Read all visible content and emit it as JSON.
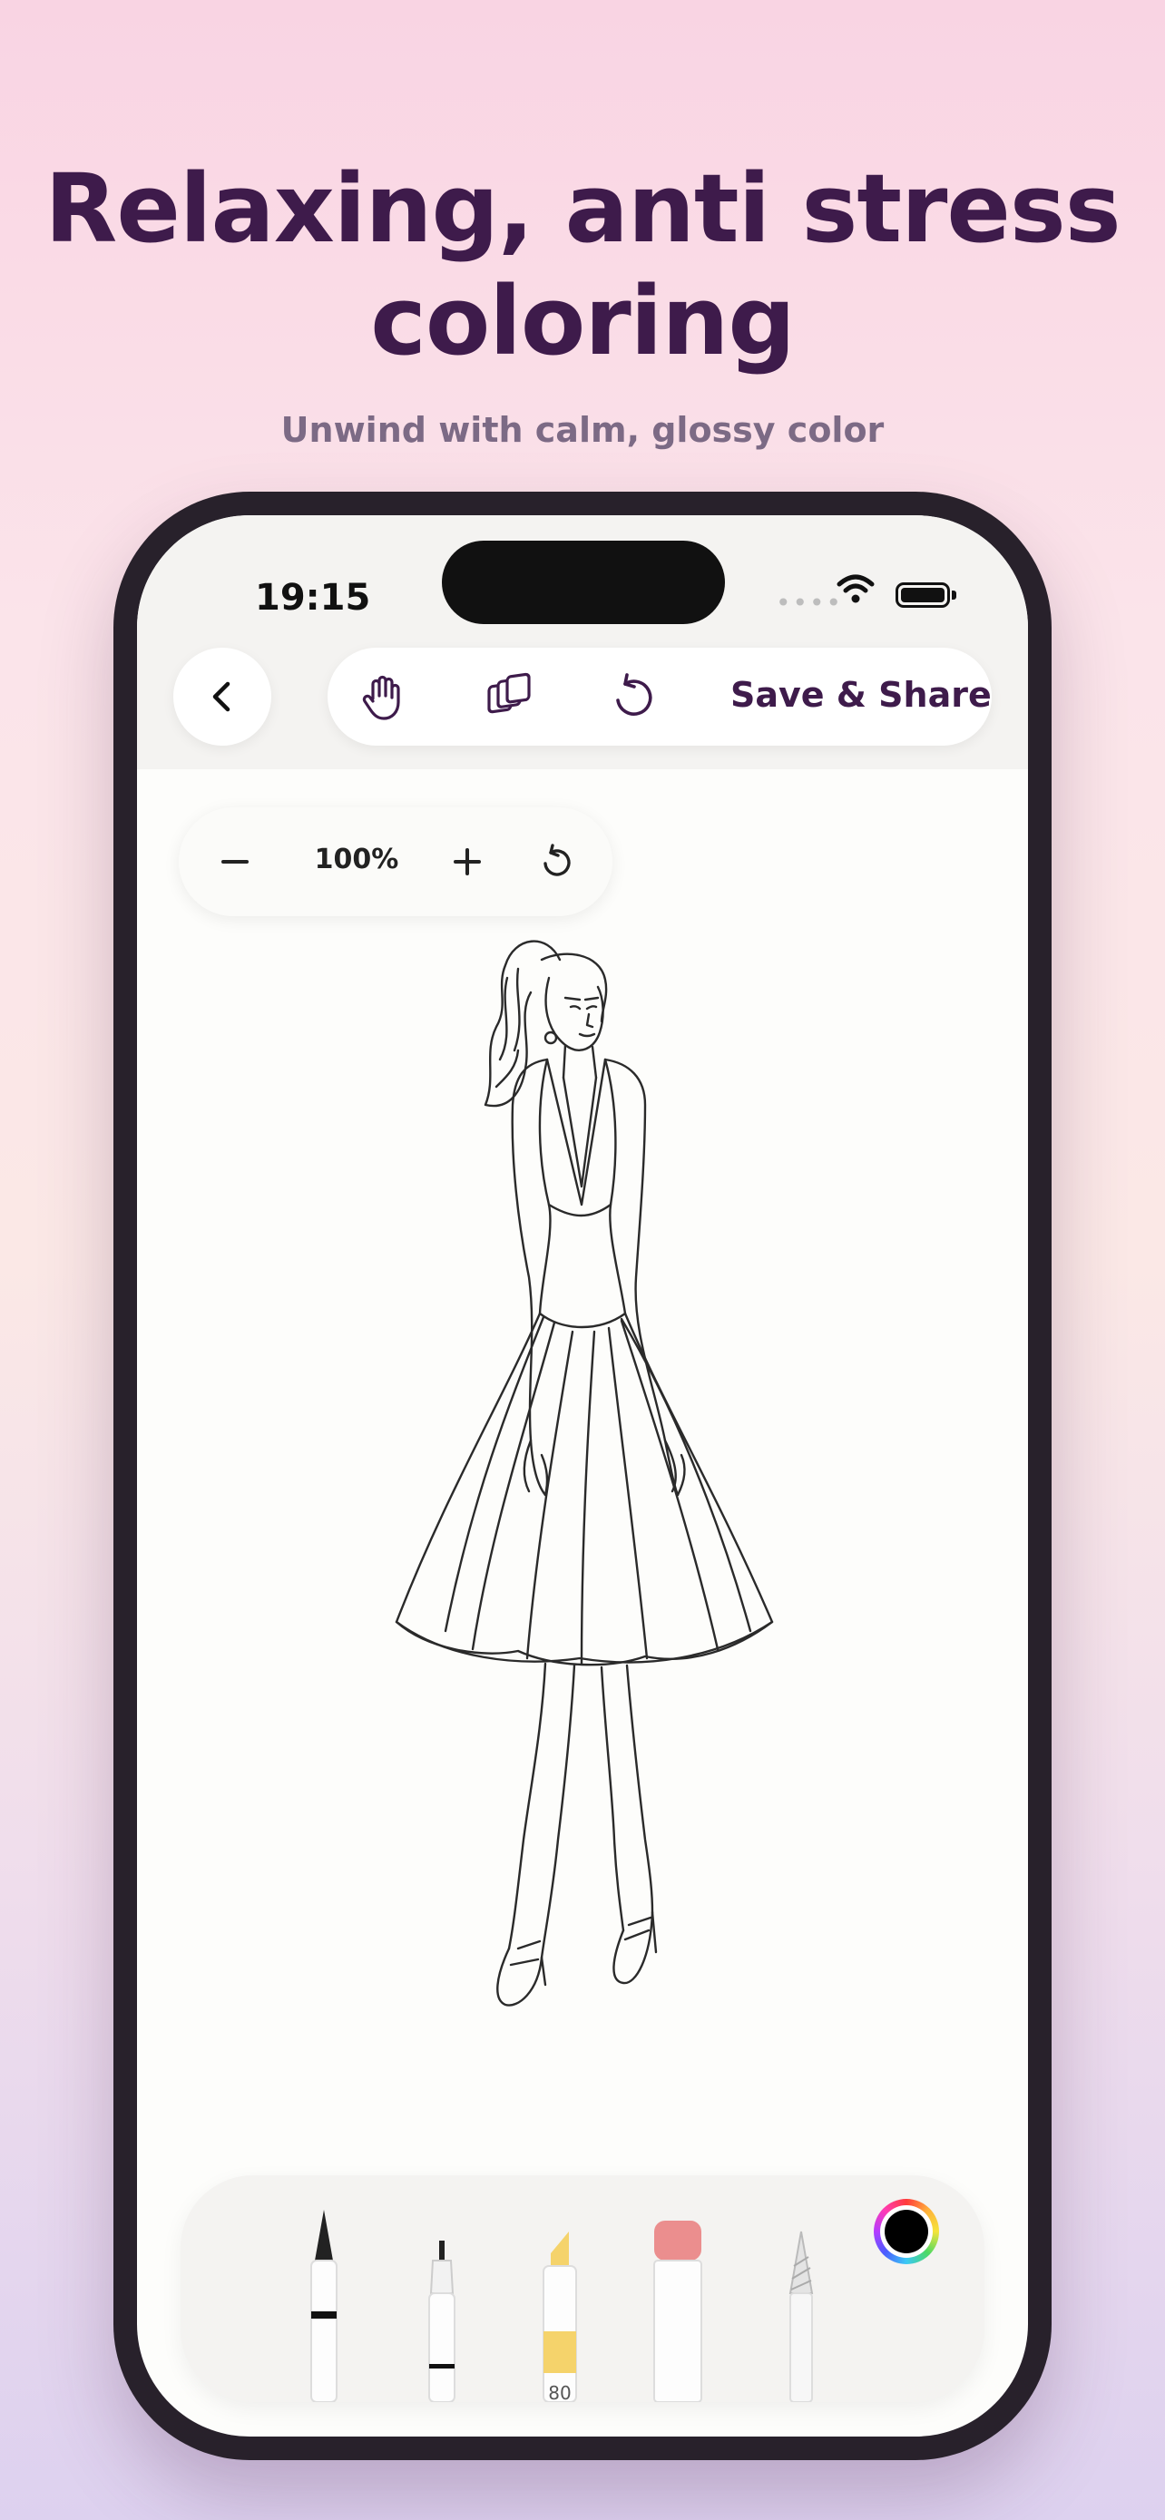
{
  "hero": {
    "title": "Relaxing, anti stress coloring",
    "subtitle": "Unwind with calm, glossy color"
  },
  "status_bar": {
    "time": "19:15"
  },
  "toolbar": {
    "save_share_label": "Save & Share",
    "icons": [
      "hand-icon",
      "layers-icon",
      "undo-icon"
    ]
  },
  "zoom": {
    "level": "100%"
  },
  "tools": {
    "items": [
      "pen",
      "fineliner",
      "highlighter",
      "marker",
      "crayon"
    ],
    "highlighter_size": "80",
    "selected_color": "#000000"
  },
  "colors": {
    "title": "#3e1b4b",
    "subtitle": "#7c6a85",
    "accent": "#3e1b4b"
  }
}
